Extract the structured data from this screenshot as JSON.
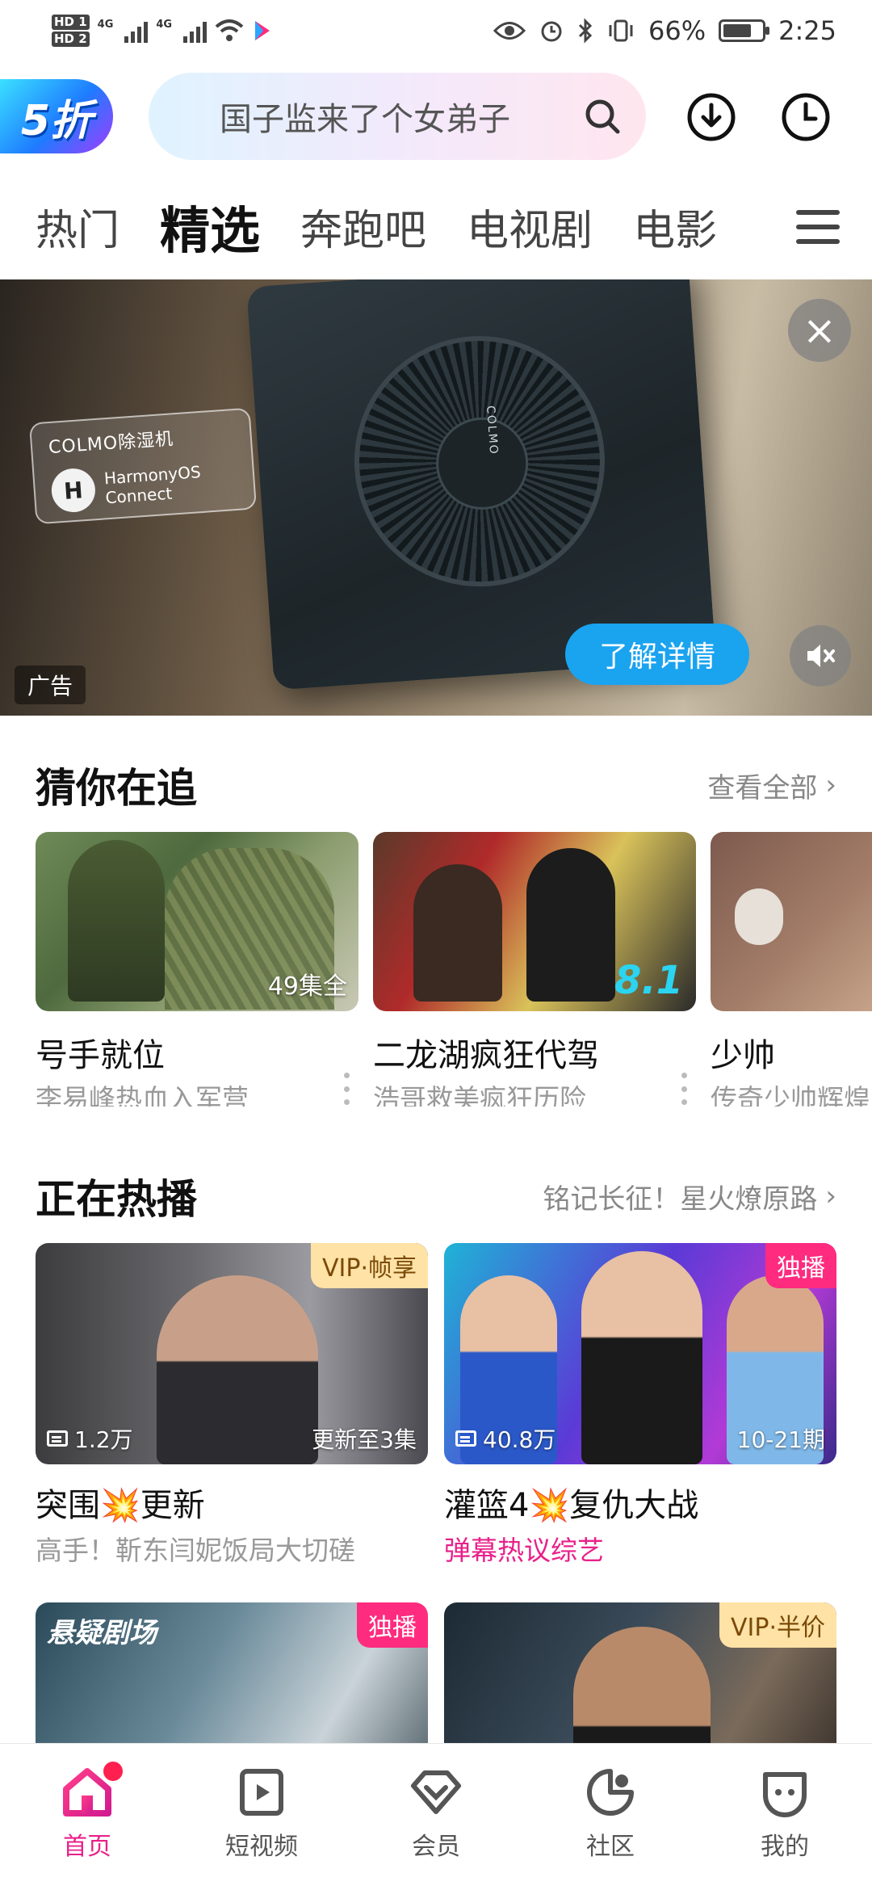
{
  "status_bar": {
    "hd1": "HD 1",
    "hd2": "HD 2",
    "net1": "4G",
    "net2": "4G",
    "battery": "66%",
    "time": "2:25"
  },
  "header": {
    "promo_badge": "5折",
    "search_placeholder": "国子监来了个女弟子",
    "download_icon": "download-icon",
    "history_icon": "history-clock-icon"
  },
  "tabs": [
    {
      "label": "热门",
      "active": false
    },
    {
      "label": "精选",
      "active": true
    },
    {
      "label": "奔跑吧",
      "active": false
    },
    {
      "label": "电视剧",
      "active": false
    },
    {
      "label": "电影",
      "active": false
    }
  ],
  "ad": {
    "brand": "COLMO除湿机",
    "platform_line1": "HarmonyOS",
    "platform_line2": "Connect",
    "device_label": "COLMO",
    "tag": "广告",
    "cta": "了解详情"
  },
  "chase": {
    "title": "猜你在追",
    "link": "查看全部",
    "items": [
      {
        "title": "号手就位",
        "subtitle": "李易峰热血入军营",
        "badge": "49集全"
      },
      {
        "title": "二龙湖疯狂代驾",
        "subtitle": "浩哥救美疯狂历险",
        "score": "8.1"
      },
      {
        "title": "少帅",
        "subtitle": "传奇少帅辉煌"
      }
    ]
  },
  "hot": {
    "title": "正在热播",
    "link": "铭记长征！星火燎原路",
    "items": [
      {
        "tag": "VIP·帧享",
        "heat": "1.2万",
        "episode": "更新至3集",
        "title": "突围💥更新",
        "subtitle": "高手！靳东闫妮饭局大切磋"
      },
      {
        "tag": "独播",
        "heat": "40.8万",
        "episode": "10-21期",
        "title": "灌篮4💥复仇大战",
        "subtitle": "弹幕热议综艺"
      },
      {
        "tag": "独播",
        "overlay": "悬疑剧场"
      },
      {
        "tag": "VIP·半价"
      }
    ]
  },
  "bottom_nav": [
    {
      "label": "首页",
      "icon": "home-icon",
      "active": true
    },
    {
      "label": "短视频",
      "icon": "short-video-icon",
      "active": false
    },
    {
      "label": "会员",
      "icon": "vip-diamond-icon",
      "active": false
    },
    {
      "label": "社区",
      "icon": "community-icon",
      "active": false
    },
    {
      "label": "我的",
      "icon": "profile-icon",
      "active": false
    }
  ],
  "colors": {
    "accent_pink": "#e8218a",
    "cta_blue": "#1aa3ef",
    "score_cyan": "#2bd4f0"
  }
}
